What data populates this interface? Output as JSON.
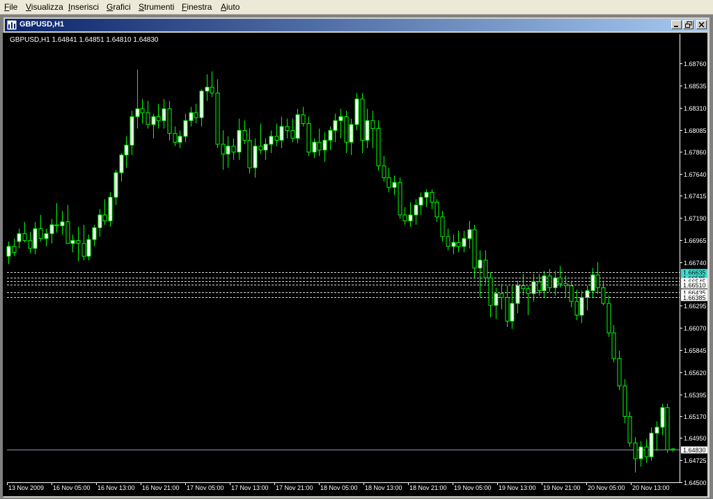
{
  "menu": [
    {
      "mnemonic": "F",
      "rest": "ile"
    },
    {
      "mnemonic": "V",
      "rest": "isualizza"
    },
    {
      "mnemonic": "I",
      "rest": "nserisci"
    },
    {
      "mnemonic": "G",
      "rest": "rafici"
    },
    {
      "mnemonic": "S",
      "rest": "trumenti"
    },
    {
      "mnemonic": "F",
      "rest": "inestra"
    },
    {
      "mnemonic": "A",
      "rest": "iuto"
    }
  ],
  "window": {
    "title": "GBPUSD,H1"
  },
  "colors": {
    "background": "#000000",
    "axis": "#ffffff",
    "bull_body": "#ffffff",
    "bear_body": "#000000",
    "wick": "#00ff00",
    "level_line": "#d8d8d8",
    "current_line": "#8c9bb4",
    "highlight_tag": "#40e0d0"
  },
  "chart_data": {
    "type": "candlestick",
    "symbol": "GBPUSD",
    "timeframe": "H1",
    "header": "GBPUSD,H1  1.64841 1.64851 1.64810 1.64830",
    "y_ticks": [
      "1.68760",
      "1.68535",
      "1.68310",
      "1.68085",
      "1.67860",
      "1.67640",
      "1.67415",
      "1.67190",
      "1.66965",
      "1.66740",
      "1.66295",
      "1.66070",
      "1.65845",
      "1.65620",
      "1.65395",
      "1.65170",
      "1.64950",
      "1.64725",
      "1.64500"
    ],
    "ylim": [
      1.645,
      1.6906
    ],
    "x_ticks": [
      "13 Nov 2009",
      "16 Nov 05:00",
      "16 Nov 13:00",
      "16 Nov 21:00",
      "17 Nov 05:00",
      "17 Nov 13:00",
      "17 Nov 21:00",
      "18 Nov 05:00",
      "18 Nov 13:00",
      "18 Nov 21:00",
      "19 Nov 05:00",
      "19 Nov 13:00",
      "19 Nov 21:00",
      "20 Nov 05:00",
      "20 Nov 13:00"
    ],
    "candles": [
      [
        1.668,
        1.6695,
        1.6672,
        1.669
      ],
      [
        1.669,
        1.6698,
        1.668,
        1.6684
      ],
      [
        1.6695,
        1.6708,
        1.6688,
        1.6703
      ],
      [
        1.6703,
        1.6715,
        1.6694,
        1.6696
      ],
      [
        1.6696,
        1.6705,
        1.6683,
        1.6688
      ],
      [
        1.6688,
        1.6715,
        1.6682,
        1.6708
      ],
      [
        1.6708,
        1.6722,
        1.6695,
        1.6698
      ],
      [
        1.6698,
        1.6708,
        1.669,
        1.6703
      ],
      [
        1.6703,
        1.6718,
        1.6693,
        1.6712
      ],
      [
        1.6712,
        1.6734,
        1.6704,
        1.6711
      ],
      [
        1.6711,
        1.6726,
        1.6702,
        1.6715
      ],
      [
        1.6715,
        1.6732,
        1.6705,
        1.6693
      ],
      [
        1.6693,
        1.6702,
        1.6684,
        1.6696
      ],
      [
        1.6696,
        1.671,
        1.6675,
        1.6693
      ],
      [
        1.6693,
        1.6712,
        1.6676,
        1.668
      ],
      [
        1.668,
        1.6702,
        1.6676,
        1.6697
      ],
      [
        1.6697,
        1.6712,
        1.669,
        1.6709
      ],
      [
        1.6709,
        1.6728,
        1.67,
        1.6722
      ],
      [
        1.6722,
        1.6738,
        1.6712,
        1.6716
      ],
      [
        1.6716,
        1.6745,
        1.671,
        1.674
      ],
      [
        1.674,
        1.6768,
        1.6732,
        1.6765
      ],
      [
        1.6765,
        1.6785,
        1.6756,
        1.6783
      ],
      [
        1.6783,
        1.6802,
        1.677,
        1.6793
      ],
      [
        1.6793,
        1.6828,
        1.6783,
        1.6822
      ],
      [
        1.6822,
        1.687,
        1.681,
        1.683
      ],
      [
        1.683,
        1.684,
        1.6815,
        1.6826
      ],
      [
        1.6826,
        1.6838,
        1.681,
        1.6814
      ],
      [
        1.6814,
        1.6825,
        1.68,
        1.6822
      ],
      [
        1.6822,
        1.6835,
        1.681,
        1.6818
      ],
      [
        1.6818,
        1.684,
        1.681,
        1.683
      ],
      [
        1.683,
        1.6838,
        1.6798,
        1.6805
      ],
      [
        1.6805,
        1.6812,
        1.6792,
        1.6796
      ],
      [
        1.6796,
        1.6808,
        1.679,
        1.6802
      ],
      [
        1.6802,
        1.6825,
        1.6796,
        1.6818
      ],
      [
        1.6818,
        1.6832,
        1.6812,
        1.6826
      ],
      [
        1.6826,
        1.6835,
        1.6815,
        1.6821
      ],
      [
        1.6821,
        1.685,
        1.6812,
        1.6848
      ],
      [
        1.6848,
        1.6865,
        1.6838,
        1.6852
      ],
      [
        1.6852,
        1.6868,
        1.6842,
        1.6846
      ],
      [
        1.6846,
        1.686,
        1.679,
        1.6794
      ],
      [
        1.6794,
        1.6808,
        1.6768,
        1.6784
      ],
      [
        1.6784,
        1.6802,
        1.677,
        1.6792
      ],
      [
        1.6792,
        1.68,
        1.6778,
        1.6786
      ],
      [
        1.6786,
        1.682,
        1.6778,
        1.6808
      ],
      [
        1.6808,
        1.6818,
        1.6794,
        1.6798
      ],
      [
        1.6798,
        1.681,
        1.6764,
        1.677
      ],
      [
        1.677,
        1.68,
        1.676,
        1.6792
      ],
      [
        1.6792,
        1.6815,
        1.6784,
        1.6788
      ],
      [
        1.6788,
        1.68,
        1.6778,
        1.6794
      ],
      [
        1.6794,
        1.6808,
        1.6785,
        1.6802
      ],
      [
        1.6802,
        1.6815,
        1.6792,
        1.6798
      ],
      [
        1.6798,
        1.6822,
        1.679,
        1.6812
      ],
      [
        1.6812,
        1.682,
        1.68,
        1.6808
      ],
      [
        1.6808,
        1.682,
        1.6796,
        1.68
      ],
      [
        1.68,
        1.683,
        1.6795,
        1.6824
      ],
      [
        1.6824,
        1.6832,
        1.6812,
        1.6815
      ],
      [
        1.6815,
        1.6822,
        1.6782,
        1.6786
      ],
      [
        1.6786,
        1.68,
        1.678,
        1.6796
      ],
      [
        1.6796,
        1.681,
        1.6782,
        1.6788
      ],
      [
        1.6788,
        1.6806,
        1.6776,
        1.6798
      ],
      [
        1.6798,
        1.6812,
        1.6788,
        1.6808
      ],
      [
        1.6808,
        1.6825,
        1.6796,
        1.6818
      ],
      [
        1.6818,
        1.683,
        1.68,
        1.6822
      ],
      [
        1.6822,
        1.6828,
        1.6785,
        1.6796
      ],
      [
        1.6796,
        1.682,
        1.6783,
        1.6814
      ],
      [
        1.6814,
        1.6846,
        1.6808,
        1.684
      ],
      [
        1.684,
        1.6846,
        1.6785,
        1.6798
      ],
      [
        1.6798,
        1.683,
        1.679,
        1.6818
      ],
      [
        1.6818,
        1.6828,
        1.679,
        1.681
      ],
      [
        1.681,
        1.6818,
        1.6767,
        1.6772
      ],
      [
        1.6772,
        1.6782,
        1.6756,
        1.676
      ],
      [
        1.676,
        1.677,
        1.6745,
        1.675
      ],
      [
        1.675,
        1.6762,
        1.6742,
        1.6755
      ],
      [
        1.6755,
        1.676,
        1.6718,
        1.6722
      ],
      [
        1.6722,
        1.673,
        1.6712,
        1.6716
      ],
      [
        1.6716,
        1.6735,
        1.671,
        1.6722
      ],
      [
        1.6722,
        1.6738,
        1.6712,
        1.6732
      ],
      [
        1.6732,
        1.6745,
        1.6722,
        1.674
      ],
      [
        1.674,
        1.6748,
        1.673,
        1.6745
      ],
      [
        1.6745,
        1.6748,
        1.6728,
        1.6735
      ],
      [
        1.6735,
        1.6738,
        1.6715,
        1.672
      ],
      [
        1.672,
        1.6726,
        1.6695,
        1.67
      ],
      [
        1.67,
        1.6708,
        1.6686,
        1.669
      ],
      [
        1.669,
        1.6702,
        1.6682,
        1.6694
      ],
      [
        1.6694,
        1.6706,
        1.6684,
        1.669
      ],
      [
        1.669,
        1.6706,
        1.6684,
        1.6698
      ],
      [
        1.6698,
        1.6716,
        1.6688,
        1.6707
      ],
      [
        1.6707,
        1.6712,
        1.6658,
        1.6668
      ],
      [
        1.6668,
        1.6686,
        1.6638,
        1.6676
      ],
      [
        1.6676,
        1.6686,
        1.6652,
        1.6658
      ],
      [
        1.6658,
        1.6664,
        1.6618,
        1.663
      ],
      [
        1.663,
        1.6648,
        1.6616,
        1.6642
      ],
      [
        1.6642,
        1.6652,
        1.6626,
        1.6638
      ],
      [
        1.6638,
        1.665,
        1.6608,
        1.6614
      ],
      [
        1.6614,
        1.665,
        1.6606,
        1.6632
      ],
      [
        1.6632,
        1.6655,
        1.6622,
        1.665
      ],
      [
        1.665,
        1.6662,
        1.664,
        1.6647
      ],
      [
        1.6647,
        1.665,
        1.662,
        1.6642
      ],
      [
        1.6642,
        1.6662,
        1.6634,
        1.6654
      ],
      [
        1.6654,
        1.6662,
        1.664,
        1.6645
      ],
      [
        1.6645,
        1.6665,
        1.6638,
        1.666
      ],
      [
        1.666,
        1.6667,
        1.6644,
        1.6648
      ],
      [
        1.6648,
        1.6665,
        1.664,
        1.6658
      ],
      [
        1.6658,
        1.667,
        1.6648,
        1.6652
      ],
      [
        1.6652,
        1.666,
        1.6638,
        1.665
      ],
      [
        1.665,
        1.6655,
        1.6628,
        1.6634
      ],
      [
        1.6634,
        1.6646,
        1.6615,
        1.662
      ],
      [
        1.662,
        1.6645,
        1.6612,
        1.6638
      ],
      [
        1.6638,
        1.665,
        1.6625,
        1.6645
      ],
      [
        1.6645,
        1.6668,
        1.6638,
        1.6661
      ],
      [
        1.6661,
        1.6674,
        1.6642,
        1.6648
      ],
      [
        1.6648,
        1.6655,
        1.663,
        1.6632
      ],
      [
        1.6632,
        1.664,
        1.6598,
        1.6602
      ],
      [
        1.6602,
        1.661,
        1.6572,
        1.6576
      ],
      [
        1.6576,
        1.6584,
        1.6544,
        1.6548
      ],
      [
        1.6548,
        1.6555,
        1.651,
        1.6517
      ],
      [
        1.6517,
        1.6522,
        1.6486,
        1.649
      ],
      [
        1.649,
        1.6496,
        1.646,
        1.6474
      ],
      [
        1.6474,
        1.6492,
        1.6466,
        1.6486
      ],
      [
        1.6486,
        1.6494,
        1.647,
        1.6476
      ],
      [
        1.6476,
        1.6506,
        1.6472,
        1.65
      ],
      [
        1.65,
        1.6512,
        1.6482,
        1.6506
      ],
      [
        1.6506,
        1.653,
        1.6498,
        1.6526
      ],
      [
        1.6526,
        1.653,
        1.648,
        1.6483
      ],
      [
        1.6484,
        1.6485,
        1.6481,
        1.6483
      ]
    ],
    "levels": [
      {
        "value": "1.66635",
        "tag_color": "#40e0d0"
      },
      {
        "value": "1.66585",
        "tag_color": "#40e0d0"
      },
      {
        "value": "1.66545",
        "tag_color": "#ffffff"
      },
      {
        "value": "1.66510",
        "tag_color": "#ffffff"
      },
      {
        "value": "1.66435",
        "tag_color": "#ffffff"
      },
      {
        "value": "1.66385",
        "tag_color": "#ffffff"
      }
    ],
    "current_price": "1.64830",
    "grid": false
  }
}
